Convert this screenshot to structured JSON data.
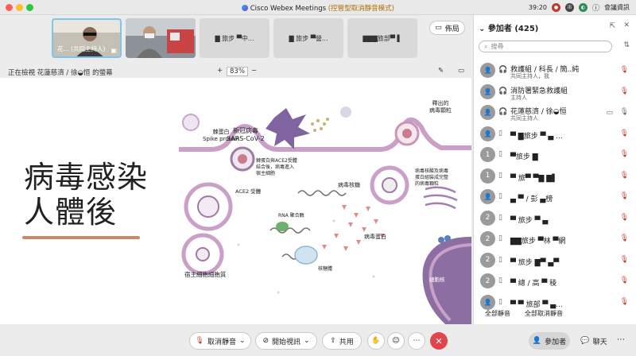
{
  "window": {
    "title": "Cisco Webex Meetings",
    "title_accent": "(控管型取消靜音模式)",
    "time": "39:20",
    "meeting_info": "會議資訊"
  },
  "thumbnails": [
    {
      "name": "花...",
      "role": "(共同主持人)"
    },
    {
      "name": ""
    },
    {
      "name": "▇ 旅步 ▀中..."
    },
    {
      "name": "▇ 旅步 ▀營..."
    },
    {
      "name": "▇▇▇旅部▀ ▌"
    }
  ],
  "layout_button": "佈局",
  "viewbar": {
    "viewing": "正在檢視 花蓮慈濟 / 徐◒恒 的螢幕",
    "zoom": "83%"
  },
  "slide": {
    "heading_line1": "病毒感染",
    "heading_line2": "人體後",
    "labels": {
      "spike": "棘蛋白\nSpike protein",
      "virus": "新冠病毒\nSARS-CoV-2",
      "bind": "棘蛋白與ACE2受體\n結合後，病毒進入\n宿主細胞",
      "ace2": "ACE2 受體",
      "rna_genome": "病毒核糖",
      "rna_poly": "RNA 聚合酶",
      "ribosome": "核糖體",
      "viral_protein": "病毒蛋白",
      "assembly": "病毒核酸及病毒\n蛋白組裝成完整\n的病毒顆粒",
      "release": "釋出的\n病毒顆粒",
      "cytoplasm": "宿主細胞細胞質",
      "nucleus": "細胞核"
    }
  },
  "toolbar": {
    "unmute": "取消靜音",
    "start_video": "開始視訊",
    "share": "共用",
    "participants": "參加者",
    "chat": "聊天"
  },
  "panel": {
    "title": "參加者 (425)",
    "search_placeholder": "搜尋",
    "participants": [
      {
        "avatar": "",
        "name": "救護組 / 科長 / 簡..純",
        "role": "共同主持人，我"
      },
      {
        "avatar": "",
        "name": "消防署緊急救護組",
        "role": "主持人"
      },
      {
        "avatar": "",
        "name": "花蓮慈濟 / 徐◒恒",
        "role": "共同主持人"
      },
      {
        "avatar": "",
        "name": "▀ ▇旅步 ▀ ▄ ...",
        "role": ""
      },
      {
        "avatar": "1",
        "name": "▀旅步 ▇",
        "role": ""
      },
      {
        "avatar": "1",
        "name": "▀ 旅▀ ▀▇ ▇▌",
        "role": ""
      },
      {
        "avatar": "",
        "name": "▄ ▀ / 彭 ▄榜",
        "role": ""
      },
      {
        "avatar": "2",
        "name": "▀ 旅步 ▀ ▄",
        "role": ""
      },
      {
        "avatar": "2",
        "name": "▇▇旅步 ▀林 ▀網",
        "role": ""
      },
      {
        "avatar": "2",
        "name": "▀ 旅步 ▇▀ ▄▀",
        "role": ""
      },
      {
        "avatar": "2",
        "name": "▀ 總 / 高 ▀ 稜",
        "role": ""
      },
      {
        "avatar": "",
        "name": "▀ ▀ 旅部 ▀ ▄...",
        "role": ""
      }
    ],
    "mute_all": "全部靜音",
    "unmute_all": "全部取消靜音"
  }
}
